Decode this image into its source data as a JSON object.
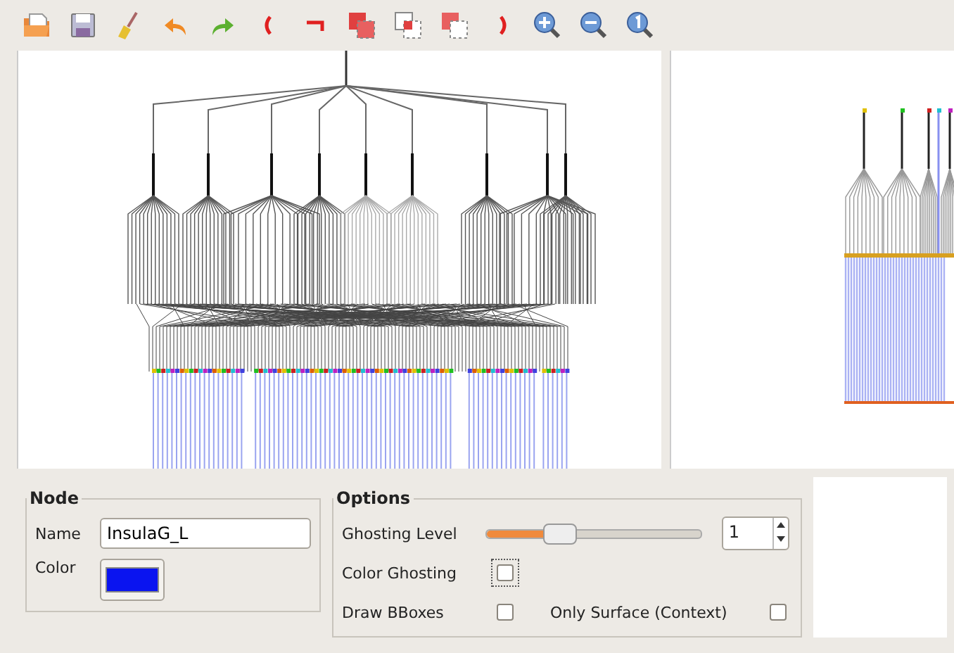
{
  "toolbar": {
    "tools": [
      {
        "kind": "open"
      },
      {
        "kind": "save"
      },
      {
        "kind": "clear"
      },
      {
        "kind": "undo"
      },
      {
        "kind": "redo"
      },
      {
        "kind": "paren-open"
      },
      {
        "kind": "not"
      },
      {
        "kind": "intersect"
      },
      {
        "kind": "subtract-a"
      },
      {
        "kind": "subtract-b"
      },
      {
        "kind": "paren-close"
      },
      {
        "kind": "zoom-in"
      },
      {
        "kind": "zoom-out"
      },
      {
        "kind": "zoom-reset"
      }
    ]
  },
  "node": {
    "title": "Node",
    "name_label": "Name",
    "name_value": "InsulaG_L",
    "color_label": "Color",
    "color": "#0a14f0"
  },
  "options": {
    "title": "Options",
    "ghosting_label": "Ghosting Level",
    "level": 0.34,
    "spin_value": "1",
    "checks": [
      {
        "label": "Color Ghosting",
        "checked": false,
        "focused": true
      },
      {
        "label": "Draw BBoxes",
        "checked": false,
        "focused": false
      },
      {
        "label": "Only Surface (Context)",
        "checked": false,
        "focused": false
      }
    ]
  }
}
